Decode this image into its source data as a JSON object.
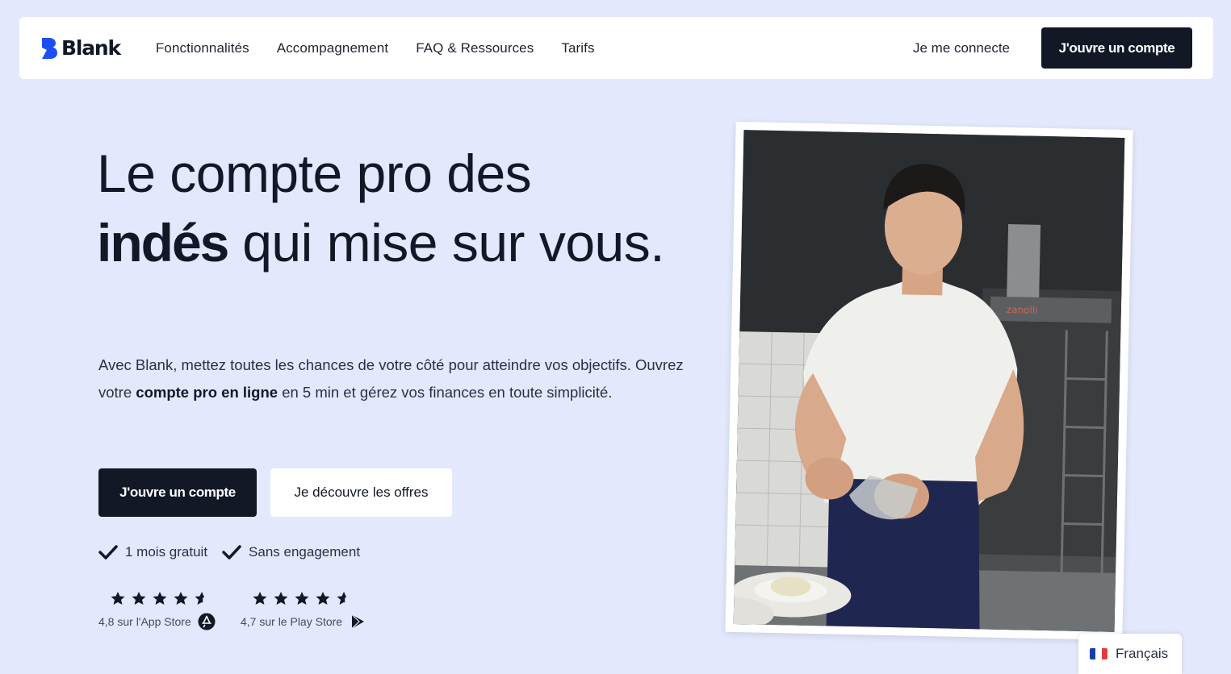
{
  "nav": {
    "logo_text": "Blank",
    "links": [
      "Fonctionnalités",
      "Accompagnement",
      "FAQ & Ressources",
      "Tarifs"
    ],
    "login": "Je me connecte",
    "cta": "J'ouvre un compte"
  },
  "hero": {
    "title_part1": "Le compte pro des",
    "title_bold": "indés",
    "title_part2": " qui mise sur vous.",
    "text_part1": "Avec Blank, mettez toutes les chances de votre côté pour atteindre vos objectifs. Ouvrez votre ",
    "text_bold": "compte pro en ligne",
    "text_part2": " en 5 min et gérez vos finances en toute simplicité.",
    "primary_button": "J'ouvre un compte",
    "secondary_button": "Je découvre les offres",
    "perks": [
      "1 mois gratuit",
      "Sans engagement"
    ]
  },
  "ratings": [
    {
      "score": 4.8,
      "stars_filled": 4.5,
      "label": "4,8 sur l'App Store",
      "icon": "app-store-icon"
    },
    {
      "score": 4.7,
      "stars_filled": 4.5,
      "label": "4,7 sur le Play Store",
      "icon": "play-store-icon"
    }
  ],
  "language": {
    "label": "Français",
    "flag": "france-flag-icon"
  },
  "colors": {
    "background": "#e3e8fc",
    "dark": "#121826",
    "brand_blue": "#1b4ff5"
  }
}
